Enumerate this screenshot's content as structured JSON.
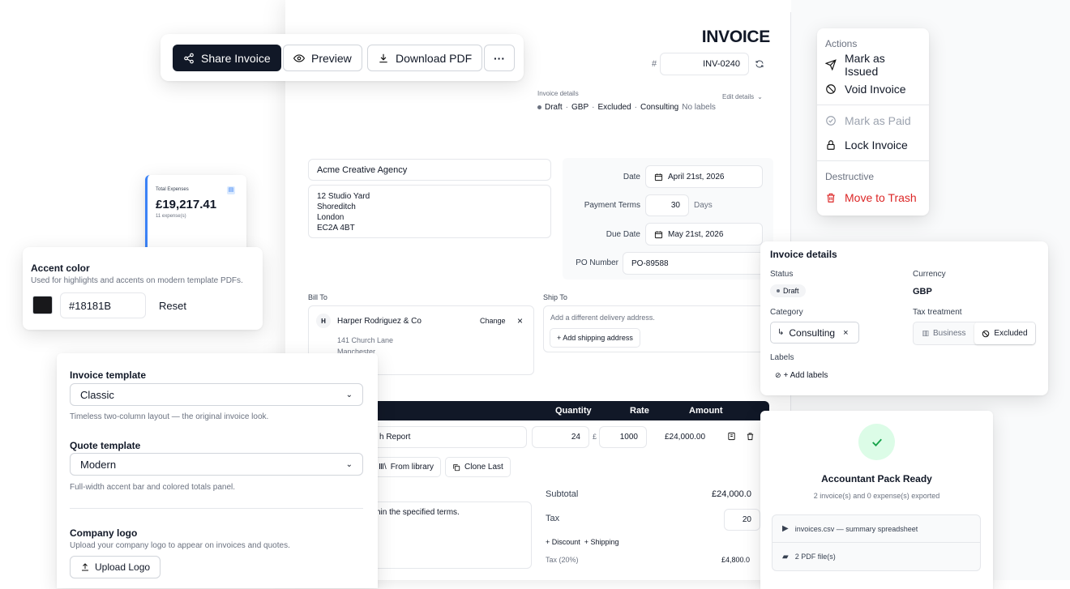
{
  "toolbar": {
    "share": "Share Invoice",
    "preview": "Preview",
    "download": "Download PDF",
    "more": "···"
  },
  "invoice": {
    "title": "INVOICE",
    "hash": "#",
    "number": "INV-0240",
    "details_label": "Invoice details",
    "edit_details": "Edit details",
    "summary": {
      "status": "Draft",
      "sep1": "·",
      "currency": "GBP",
      "sep2": "·",
      "tax": "Excluded",
      "sep3": "·",
      "category": "Consulting",
      "labels": "No labels"
    },
    "from_name": "Acme Creative Agency",
    "from_address": [
      "12 Studio Yard",
      "Shoreditch",
      "London",
      "EC2A 4BT"
    ],
    "date_label": "Date",
    "date_value": "April 21st, 2026",
    "terms_label": "Payment Terms",
    "terms_value": "30",
    "terms_unit": "Days",
    "due_label": "Due Date",
    "due_value": "May 21st, 2026",
    "po_label": "PO Number",
    "po_value": "PO-89588",
    "bill_to": "Bill To",
    "ship_to": "Ship To",
    "client_initial": "H",
    "client_name": "Harper Rodriguez & Co",
    "client_change": "Change",
    "client_remove": "×",
    "client_address": [
      "141 Church Lane",
      "Manchester"
    ],
    "ship_hint": "Add a different delivery address.",
    "add_shipping": "+ Add shipping address",
    "table_headers": {
      "quantity": "Quantity",
      "rate": "Rate",
      "amount": "Amount"
    },
    "line": {
      "description": "h Report",
      "quantity": "24",
      "currency": "£",
      "rate": "1000",
      "amount": "£24,000.00"
    },
    "from_library": "From library",
    "clone_last": "Clone Last",
    "notes_text": "ithin the specified terms.",
    "subtotal_label": "Subtotal",
    "subtotal_value": "£24,000.0",
    "tax_label": "Tax",
    "tax_value": "20",
    "discount_shipping": "+ Discount  + Shipping",
    "tax_line_label": "Tax (20%)",
    "tax_line_value": "£4,800.0"
  },
  "actions_menu": {
    "header": "Actions",
    "issued": "Mark as Issued",
    "void": "Void Invoice",
    "paid": "Mark as Paid",
    "lock": "Lock Invoice",
    "destructive": "Destructive",
    "trash": "Move to Trash"
  },
  "expenses": {
    "label": "Total Expenses",
    "amount": "£19,217.41",
    "count": "11 expense(s)"
  },
  "accent": {
    "title": "Accent color",
    "desc": "Used for highlights and accents on modern template PDFs.",
    "value": "#18181B",
    "reset": "Reset",
    "swatch": "#18181b"
  },
  "details_panel": {
    "title": "Invoice details",
    "status_label": "Status",
    "status_value": "Draft",
    "currency_label": "Currency",
    "currency_value": "GBP",
    "category_label": "Category",
    "category_value": "Consulting",
    "category_remove": "×",
    "tax_label": "Tax treatment",
    "tax_business": "Business",
    "tax_excluded": "Excluded",
    "labels_label": "Labels",
    "add_labels": "+ Add labels"
  },
  "templates": {
    "invoice_label": "Invoice template",
    "invoice_value": "Classic",
    "invoice_desc": "Timeless two-column layout — the original invoice look.",
    "quote_label": "Quote template",
    "quote_value": "Modern",
    "quote_desc": "Full-width accent bar and colored totals panel.",
    "logo_label": "Company logo",
    "logo_desc": "Upload your company logo to appear on invoices and quotes.",
    "upload": "Upload Logo"
  },
  "accountant": {
    "title": "Accountant Pack Ready",
    "desc": "2 invoice(s) and 0 expense(s) exported",
    "file1": "invoices.csv — summary spreadsheet",
    "file2": "2 PDF file(s)"
  }
}
